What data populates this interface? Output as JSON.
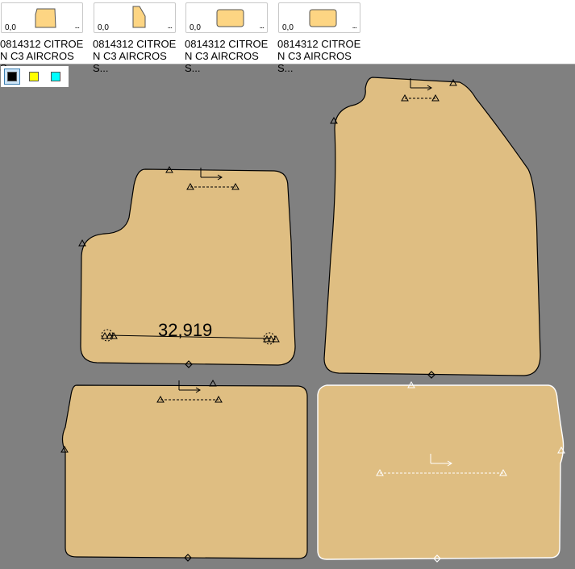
{
  "thumbnails": [
    {
      "label": "0814312 CITROEN C3 AIRCROSS...",
      "count": "0,0",
      "more": "...",
      "icon": "mat-front-left-icon"
    },
    {
      "label": "0814312 CITROEN C3 AIRCROSS...",
      "count": "0,0",
      "more": "...",
      "icon": "mat-front-right-icon"
    },
    {
      "label": "0814312 CITROEN C3 AIRCROSS...",
      "count": "0,0",
      "more": "...",
      "icon": "mat-rear-left-icon"
    },
    {
      "label": "0814312 CITROEN C3 AIRCROSS...",
      "count": "0,0",
      "more": "...",
      "icon": "mat-rear-right-icon"
    }
  ],
  "swatches": [
    {
      "color": "#000000",
      "selected": true
    },
    {
      "color": "#ffff00",
      "selected": false
    },
    {
      "color": "#00ffff",
      "selected": false
    }
  ],
  "canvas": {
    "background": "#808080",
    "piece_fill": "#dfbe82",
    "measurement": "32,919"
  }
}
